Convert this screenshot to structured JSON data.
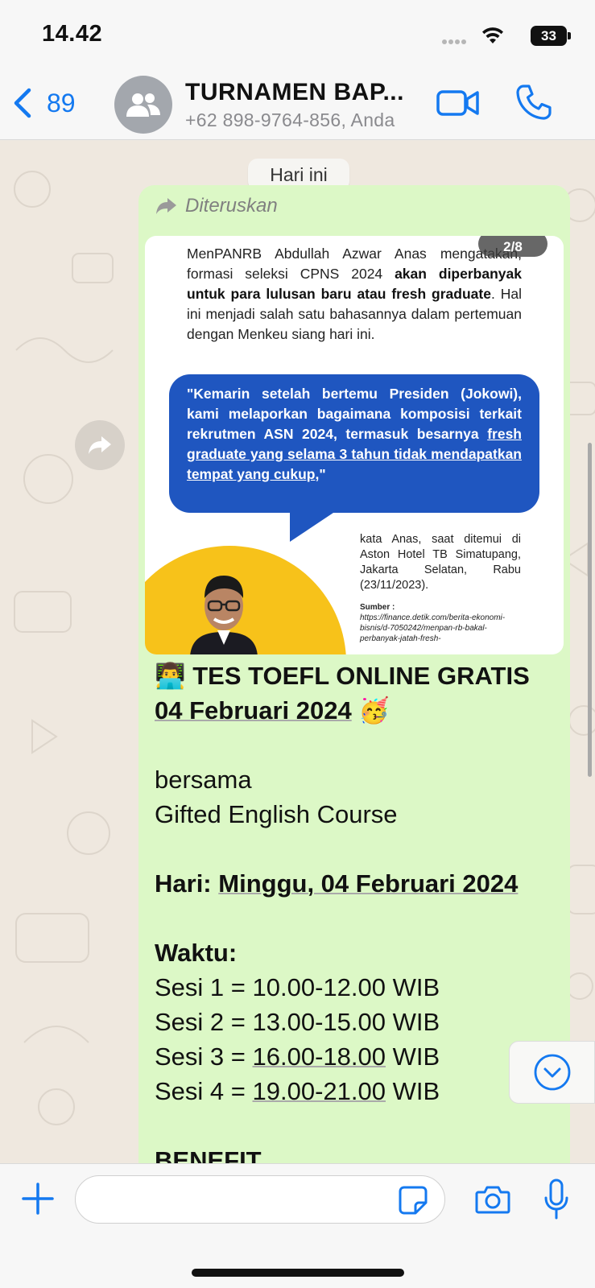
{
  "status_bar": {
    "time": "14.42",
    "battery": "33"
  },
  "header": {
    "back_count": "89",
    "title": "TURNAMEN BAP...",
    "subtitle": "+62 898-9764-856, Anda"
  },
  "chat": {
    "date_chip": "Hari ini",
    "message": {
      "forwarded_label": "Diteruskan",
      "media": {
        "counter": "2/8",
        "paragraph_start": "MenPANRB Abdullah Azwar Anas mengatakan, formasi seleksi CPNS 2024 ",
        "paragraph_bold": "akan diperbanyak untuk para lulusan baru atau fresh graduate",
        "paragraph_end": ". Hal ini menjadi salah satu bahasannya dalam pertemuan dengan Menkeu siang hari ini.",
        "quote_start": "\"Kemarin setelah bertemu Presiden (Jokowi), kami melaporkan bagaimana komposisi terkait rekrutmen ASN 2024, termasuk besarnya ",
        "quote_underlined": "fresh graduate yang selama 3 tahun tidak mendapatkan tempat yang cukup",
        "quote_end": ",\"",
        "caption": "kata Anas, saat ditemui di Aston Hotel TB Simatupang, Jakarta Selatan, Rabu (23/11/2023).",
        "source_label": "Sumber :",
        "source_url": "https://finance.detik.com/berita-ekonomi-bisnis/d-7050242/menpan-rb-bakal-perbanyak-jatah-fresh-"
      },
      "text": {
        "emoji_start": "👨‍💻",
        "headline_1": "TES TOEFL ONLINE GRATIS",
        "headline_2": "04 Februari 2024",
        "emoji_end": "🥳",
        "line_with": "bersama",
        "line_course": "Gifted English Course",
        "day_label": "Hari:",
        "day_value": "Minggu, 04 Februari 2024",
        "time_label": "Waktu:",
        "sessions": [
          {
            "prefix": "Sesi 1 = ",
            "time": "10.00-12.00",
            "suffix": " WIB"
          },
          {
            "prefix": "Sesi 2 = ",
            "time": "13.00-15.00",
            "suffix": " WIB"
          },
          {
            "prefix": "Sesi 3 = ",
            "time": "16.00-18.00",
            "suffix": " WIB"
          },
          {
            "prefix": "Sesi 4 = ",
            "time": "19.00-21.00",
            "suffix": " WIB"
          }
        ],
        "benefit_label": "BENEFIT"
      }
    }
  },
  "input": {
    "placeholder": ""
  },
  "colors": {
    "accent": "#1479f0",
    "bubble": "#dcf8c6",
    "quote_box": "#1f56c0",
    "yellow": "#f7c21a"
  },
  "icons": [
    "signal-icon",
    "wifi-icon",
    "battery-icon",
    "back-chevron-icon",
    "group-icon",
    "video-icon",
    "phone-icon",
    "forward-icon",
    "chevron-down-icon",
    "plus-icon",
    "sticker-icon",
    "camera-icon",
    "mic-icon"
  ]
}
